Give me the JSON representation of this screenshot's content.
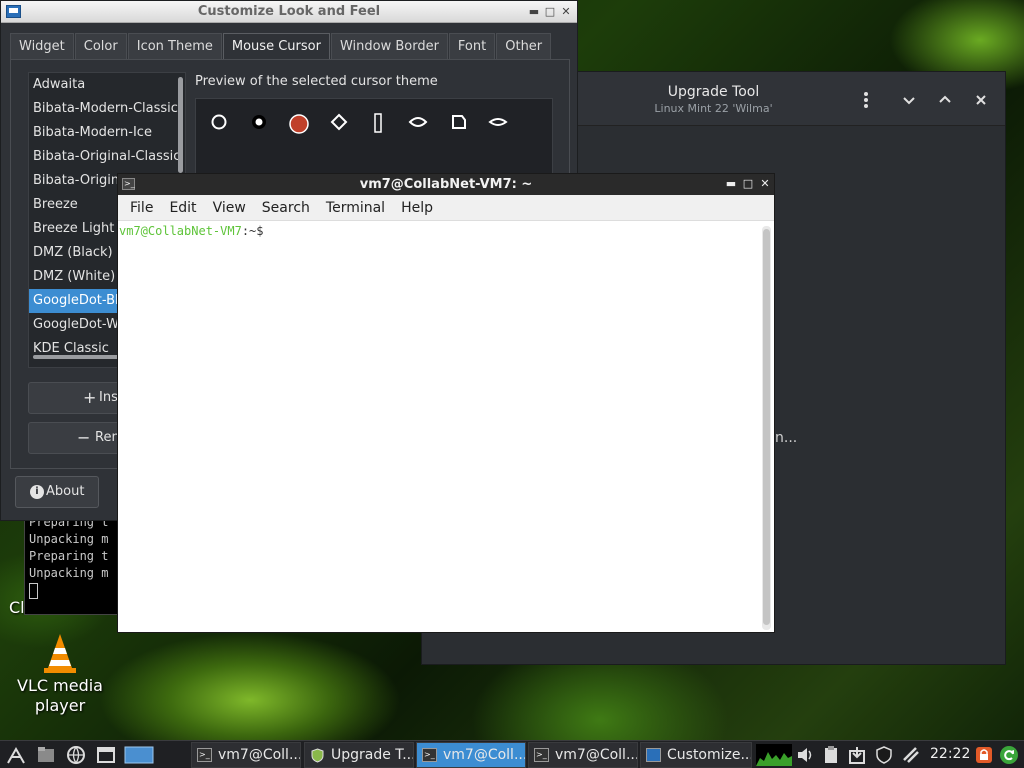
{
  "desktop": {
    "vlc_label_line1": "VLC media",
    "vlc_label_line2": "player",
    "partial_label": "Cl"
  },
  "bg_terminal": {
    "lines": [
      "Preparing t",
      "Unpacking m",
      "Preparing t",
      "Unpacking m"
    ]
  },
  "upgrade_tool": {
    "title": "Upgrade Tool",
    "subtitle": "Linux Mint 22 'Wilma'",
    "text_fragment": "n..."
  },
  "customize": {
    "title": "Customize Look and Feel",
    "tabs": [
      "Widget",
      "Color",
      "Icon Theme",
      "Mouse Cursor",
      "Window Border",
      "Font",
      "Other"
    ],
    "active_tab": "Mouse Cursor",
    "themes": [
      "Adwaita",
      "Bibata-Modern-Classic",
      "Bibata-Modern-Ice",
      "Bibata-Original-Classic",
      "Bibata-Original-Ice",
      "Breeze",
      "Breeze Light",
      "DMZ (Black)",
      "DMZ (White)",
      "GoogleDot-Black",
      "GoogleDot-White",
      "KDE Classic"
    ],
    "selected_theme": "GoogleDot-Black",
    "preview_label": "Preview of the selected cursor theme",
    "install_label": "Ins",
    "remove_label": "Ren",
    "about_label": "About"
  },
  "terminal": {
    "title": "vm7@CollabNet-VM7: ~",
    "menu": [
      "File",
      "Edit",
      "View",
      "Search",
      "Terminal",
      "Help"
    ],
    "prompt_user": "vm7@CollabNet-VM7",
    "prompt_path": ":~$"
  },
  "taskbar": {
    "items": [
      {
        "label": "vm7@Coll...",
        "active": false
      },
      {
        "label": "Upgrade T...",
        "active": false
      },
      {
        "label": "vm7@Coll...",
        "active": true
      },
      {
        "label": "vm7@Coll...",
        "active": false
      },
      {
        "label": "Customize...",
        "active": false
      }
    ],
    "clock": "22:22"
  },
  "colors": {
    "accent": "#3c8dd2",
    "prompt_green": "#5fc43a"
  }
}
